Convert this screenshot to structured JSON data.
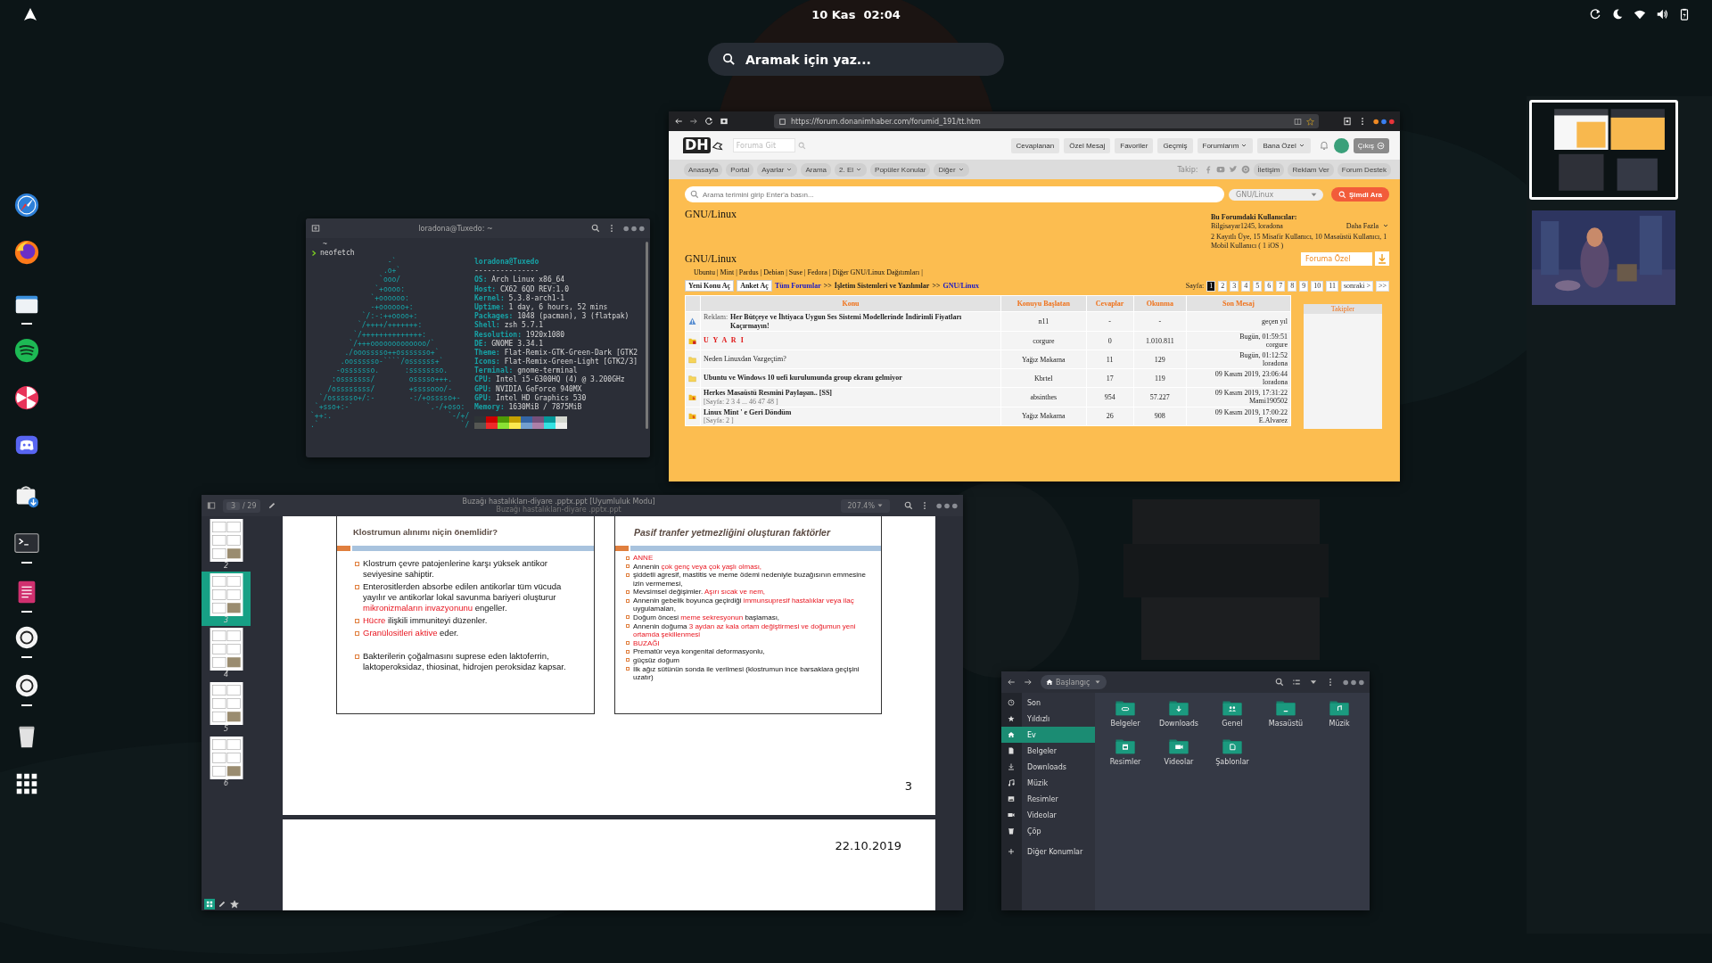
{
  "top_bar": {
    "clock": "10 Kas  02:04"
  },
  "search": {
    "placeholder": "Aramak için yaz..."
  },
  "dash": [
    {
      "running": false
    },
    {
      "running": false
    },
    {
      "running": true
    },
    {
      "running": false
    },
    {
      "running": false
    },
    {
      "running": false
    },
    {
      "running": false
    },
    {
      "running": true
    },
    {
      "running": true
    },
    {
      "running": true
    },
    {
      "running": true
    },
    {
      "running": false
    },
    {
      "running": false
    }
  ],
  "terminal": {
    "title": "loradona@Tuxedo: ~",
    "prompt_dir": "~",
    "command": "neofetch",
    "art": [
      "                  -`",
      "                 .o+`",
      "                `ooo/",
      "               `+oooo:",
      "              `+oooooo:",
      "              -+oooooo+:",
      "            `/:-:++oooo+:",
      "           `/++++/+++++++:",
      "          `/++++++++++++++:",
      "         `/+++ooooooooooooo/`",
      "        ./ooosssso++osssssso+`",
      "       .oossssso-````/ossssss+`",
      "      -osssssso.      :ssssssso.",
      "     :osssssss/        osssso+++.",
      "    /ossssssss/        +ssssooo/-",
      "  `/ossssso+/:-        -:/+osssso+-",
      " `+sso+:-`                 `.-/+oso:",
      "`++:.                           `-/+/",
      ".`                                 `/"
    ],
    "user": "loradona@Tuxedo",
    "separator": "---------------",
    "info": [
      {
        "key": "OS:",
        "value": "Arch Linux x86_64"
      },
      {
        "key": "Host:",
        "value": "CX62 6QD REV:1.0"
      },
      {
        "key": "Kernel:",
        "value": "5.3.8-arch1-1"
      },
      {
        "key": "Uptime:",
        "value": "1 day, 6 hours, 52 mins"
      },
      {
        "key": "Packages:",
        "value": "1048 (pacman), 3 (flatpak)"
      },
      {
        "key": "Shell:",
        "value": "zsh 5.7.1"
      },
      {
        "key": "Resolution:",
        "value": "1920x1080"
      },
      {
        "key": "DE:",
        "value": "GNOME 3.34.1"
      },
      {
        "key": "Theme:",
        "value": "Flat-Remix-GTK-Green-Dark [GTK2"
      },
      {
        "key": "Icons:",
        "value": "Flat-Remix-Green-Light [GTK2/3]"
      },
      {
        "key": "Terminal:",
        "value": "gnome-terminal"
      },
      {
        "key": "CPU:",
        "value": "Intel i5-6300HQ (4) @ 3.200GHz"
      },
      {
        "key": "GPU:",
        "value": "NVIDIA GeForce 940MX"
      },
      {
        "key": "GPU:",
        "value": "Intel HD Graphics 530"
      },
      {
        "key": "Memory:",
        "value": "1630MiB / 7875MiB"
      }
    ],
    "palette": [
      {
        "color": "#2e3436"
      },
      {
        "color": "#cc0000"
      },
      {
        "color": "#4e9a06"
      },
      {
        "color": "#c4a000"
      },
      {
        "color": "#3465a4"
      },
      {
        "color": "#75507b"
      },
      {
        "color": "#06989a"
      },
      {
        "color": "#d3d7cf"
      },
      {
        "color": "#555753"
      },
      {
        "color": "#ef2929"
      },
      {
        "color": "#8ae234"
      },
      {
        "color": "#fce94f"
      },
      {
        "color": "#729fcf"
      },
      {
        "color": "#ad7fa8"
      },
      {
        "color": "#34e2e2"
      },
      {
        "color": "#eeeeec"
      }
    ]
  },
  "browser": {
    "url": "https://forum.donanimhaber.com/forumid_191/tt.htm",
    "logo": "DH",
    "goto_placeholder": "Foruma Git",
    "header_buttons": [
      {
        "label": "Cevaplanan",
        "dropdown": false
      },
      {
        "label": "Özel Mesaj",
        "dropdown": false
      },
      {
        "label": "Favoriler",
        "dropdown": false
      },
      {
        "label": "Geçmiş",
        "dropdown": false
      },
      {
        "label": "Forumlarım",
        "dropdown": true
      },
      {
        "label": "Bana Özel",
        "dropdown": true
      }
    ],
    "logout": "Çıkış",
    "nav": [
      {
        "label": "Anasayfa",
        "dropdown": false
      },
      {
        "label": "Portal",
        "dropdown": false
      },
      {
        "label": "Ayarlar",
        "dropdown": true
      },
      {
        "label": "Arama",
        "dropdown": false
      },
      {
        "label": "2. El",
        "dropdown": true
      },
      {
        "label": "Popüler Konular",
        "dropdown": false
      },
      {
        "label": "Diğer",
        "dropdown": true
      }
    ],
    "follow_label": "Takip:",
    "links": [
      "İletişim",
      "Reklam Ver",
      "Forum Destek"
    ],
    "search_placeholder": "Arama terimini girip Enter'a basın...",
    "scope": "GNU/Linux",
    "search_button": "Şimdi Ara",
    "title": "GNU/Linux",
    "users": {
      "heading": "Bu Forumdaki Kullanıcılar:",
      "names": "Bilgisayar1245, loradona",
      "more": "Daha Fazla",
      "stats": "2 Kayıtlı Üye, 15 Misafir Kullanıcı, 10 Masaüstü Kullanıcı, 1 Mobil Kullanıcı ( 1 iOS )"
    },
    "forum_title": "GNU/Linux",
    "filter": "Foruma Özel",
    "subforums": "Ubuntu | Mint | Pardus | Debian | Suse | Fedora | Diğer GNU/Linux Dağıtımları |",
    "actions": [
      "Yeni Konu Aç",
      "Anket Aç"
    ],
    "breadcrumb": [
      {
        "label": "Tüm Forumlar",
        "link": true
      },
      {
        "label": ">>",
        "link": false
      },
      {
        "label": "İşletim Sistemleri ve Yazılımlar",
        "link": false
      },
      {
        "label": ">>",
        "link": false
      },
      {
        "label": "GNU/Linux",
        "link": true
      }
    ],
    "pages_label": "Sayfa:",
    "pages": [
      {
        "label": "1",
        "selected": true
      },
      {
        "label": "2",
        "selected": false
      },
      {
        "label": "3",
        "selected": false
      },
      {
        "label": "4",
        "selected": false
      },
      {
        "label": "5",
        "selected": false
      },
      {
        "label": "6",
        "selected": false
      },
      {
        "label": "7",
        "selected": false
      },
      {
        "label": "8",
        "selected": false
      },
      {
        "label": "9",
        "selected": false
      },
      {
        "label": "10",
        "selected": false
      },
      {
        "label": "11",
        "selected": false
      },
      {
        "label": "sonraki >",
        "selected": false
      },
      {
        "label": ">>",
        "selected": false
      }
    ],
    "columns": [
      "Konu",
      "Konuyu Başlatan",
      "Cevaplar",
      "Okunma",
      "Son Mesaj"
    ],
    "rows": [
      {
        "kind": "ad",
        "prefix": "Reklam:",
        "title": "Her Bütçeye ve İhtiyaca Uygun Ses Sistemi Modellerinde İndirimli Fiyatları Kaçırmayın!",
        "unread": true,
        "starter": "n11",
        "replies": "-",
        "views": "-",
        "last_time": "geçen yıl"
      },
      {
        "kind": "warning",
        "title": "U Y A R I",
        "unread": true,
        "starter": "corgure",
        "replies": "0",
        "views": "1.010.811",
        "last_time": "Bugün, 01:59:51",
        "last_user": "corgure"
      },
      {
        "kind": "folder",
        "title": "Neden Linuxdan Vazgeçtim?",
        "unread": false,
        "starter": "Yağız Makarna",
        "replies": "11",
        "views": "129",
        "last_time": "Bugün, 01:12:52",
        "last_user": "loradona"
      },
      {
        "kind": "folder",
        "title": "Ubuntu ve Windows 10 uefi kurulumunda group ekranı gelmiyor",
        "unread": true,
        "starter": "Kbrtel",
        "replies": "17",
        "views": "119",
        "last_time": "09 Kasım 2019, 23:06:44",
        "last_user": "loradona"
      },
      {
        "kind": "hot",
        "title": "Herkes Masaüstü Resmini Paylaşsın.. [SS]",
        "pages": "[Sayfa: 2 3 4 ... 46 47 48 ]",
        "unread": true,
        "starter": "absinthes",
        "replies": "954",
        "views": "57.227",
        "last_time": "09 Kasım 2019, 17:31:22",
        "last_user": "Mami190502"
      },
      {
        "kind": "hot",
        "title": "Linux Mint ' e Geri Döndüm",
        "pages": "[Sayfa: 2 ]",
        "unread": true,
        "starter": "Yağız Makarna",
        "replies": "26",
        "views": "908",
        "last_time": "09 Kasım 2019, 17:00:22",
        "last_user": "E.Alvarez"
      }
    ],
    "side_heading": "Takipler"
  },
  "document": {
    "page": "3",
    "page_count": "/ 29",
    "title": "Buzağı hastalıkları-diyare .pptx.ppt [Uyumluluk Modu]",
    "subtitle": "Buzağı hastalıkları-diyare .pptx.ppt",
    "zoom": "207.4%",
    "thumbnails": [
      {
        "number": "2",
        "selected": false
      },
      {
        "number": "3",
        "selected": true
      },
      {
        "number": "4",
        "selected": false
      },
      {
        "number": "5",
        "selected": false
      },
      {
        "number": "6",
        "selected": false
      }
    ],
    "slides": [
      {
        "title": "Klostrumun alınımı niçin önemlidir?",
        "italic": false,
        "bullets": [
          [
            {
              "t": "Klostrum çevre patojenlerine karşı yüksek antikor seviyesine sahiptir.",
              "red": false
            }
          ],
          [
            {
              "t": "Enterositlerden absorbe edilen antikorlar tüm vücuda yayılır ve antikorlar lokal savunma bariyeri oluşturur ",
              "red": false
            },
            {
              "t": "mikronizmaların invazyonunu",
              "red": true
            },
            {
              "t": " engeller.",
              "red": false
            }
          ],
          [
            {
              "t": "Hücre",
              "red": true
            },
            {
              "t": " ilişkili immuniteyi düzenler.",
              "red": false
            }
          ],
          [
            {
              "t": "Granülositleri aktive",
              "red": true
            },
            {
              "t": " eder.",
              "red": false
            }
          ],
          [
            {
              "t": "Bakterilerin çoğalmasını suprese eden laktoferrin, laktoperoksidaz, thiosinat, hidrojen peroksidaz kapsar.",
              "red": false
            }
          ]
        ]
      },
      {
        "title": "Pasif tranfer yetmezliğini oluşturan faktörler",
        "italic": true,
        "bullets": [
          [
            {
              "t": "ANNE",
              "red": true
            }
          ],
          [
            {
              "t": "Annenin ",
              "red": false
            },
            {
              "t": "çok genç veya çok yaşlı olması,",
              "red": true
            }
          ],
          [
            {
              "t": "şiddetli agresif, mastitis ve meme ödemi  nedeniyle buzağısının emmesine izin vermemesi,",
              "red": false
            }
          ],
          [
            {
              "t": "Mevsimsel değişimler. ",
              "red": false
            },
            {
              "t": "Aşırı sıcak ve nem,",
              "red": true
            }
          ],
          [
            {
              "t": "Annenin gebelik boyunca geçirdiği ",
              "red": false
            },
            {
              "t": "immunsupresif hastalıklar veya ilaç",
              "red": true
            },
            {
              "t": " uygulamaları,",
              "red": false
            }
          ],
          [
            {
              "t": "Doğum öncesi ",
              "red": false
            },
            {
              "t": "meme sekresyonun",
              "red": true
            },
            {
              "t": " başlaması,",
              "red": false
            }
          ],
          [
            {
              "t": "Annenin doğuma ",
              "red": false
            },
            {
              "t": "3 aydan az kala ortam değiştirmesi ve doğumun yeni ortamda şekillenmesi",
              "red": true
            }
          ],
          [
            {
              "t": "BUZAĞI",
              "red": true
            }
          ],
          [
            {
              "t": "Prematür veya kongenital deformasyonlu,",
              "red": false
            }
          ],
          [
            {
              "t": "güçsüz doğum",
              "red": false
            }
          ],
          [
            {
              "t": "İlk ağız sütünün sonda ile verilmesi (klostrumun ince barsaklara geçişini uzatır)",
              "red": false
            }
          ]
        ]
      }
    ],
    "page_number": "3",
    "date": "22.10.2019"
  },
  "files": {
    "location": "Başlangıç",
    "sidebar": [
      {
        "label": "Son",
        "selected": false
      },
      {
        "label": "Yıldızlı",
        "selected": false
      },
      {
        "label": "Ev",
        "selected": true
      },
      {
        "label": "Belgeler",
        "selected": false
      },
      {
        "label": "Downloads",
        "selected": false
      },
      {
        "label": "Müzik",
        "selected": false
      },
      {
        "label": "Resimler",
        "selected": false
      },
      {
        "label": "Videolar",
        "selected": false
      },
      {
        "label": "Çöp",
        "selected": false
      },
      {
        "label": "Diğer Konumlar",
        "selected": false
      }
    ],
    "folders": [
      "Belgeler",
      "Downloads",
      "Genel",
      "Masaüstü",
      "Müzik",
      "Resimler",
      "Videolar",
      "Şablonlar"
    ]
  },
  "workspaces": [
    {
      "selected": true
    },
    {
      "selected": false
    }
  ]
}
